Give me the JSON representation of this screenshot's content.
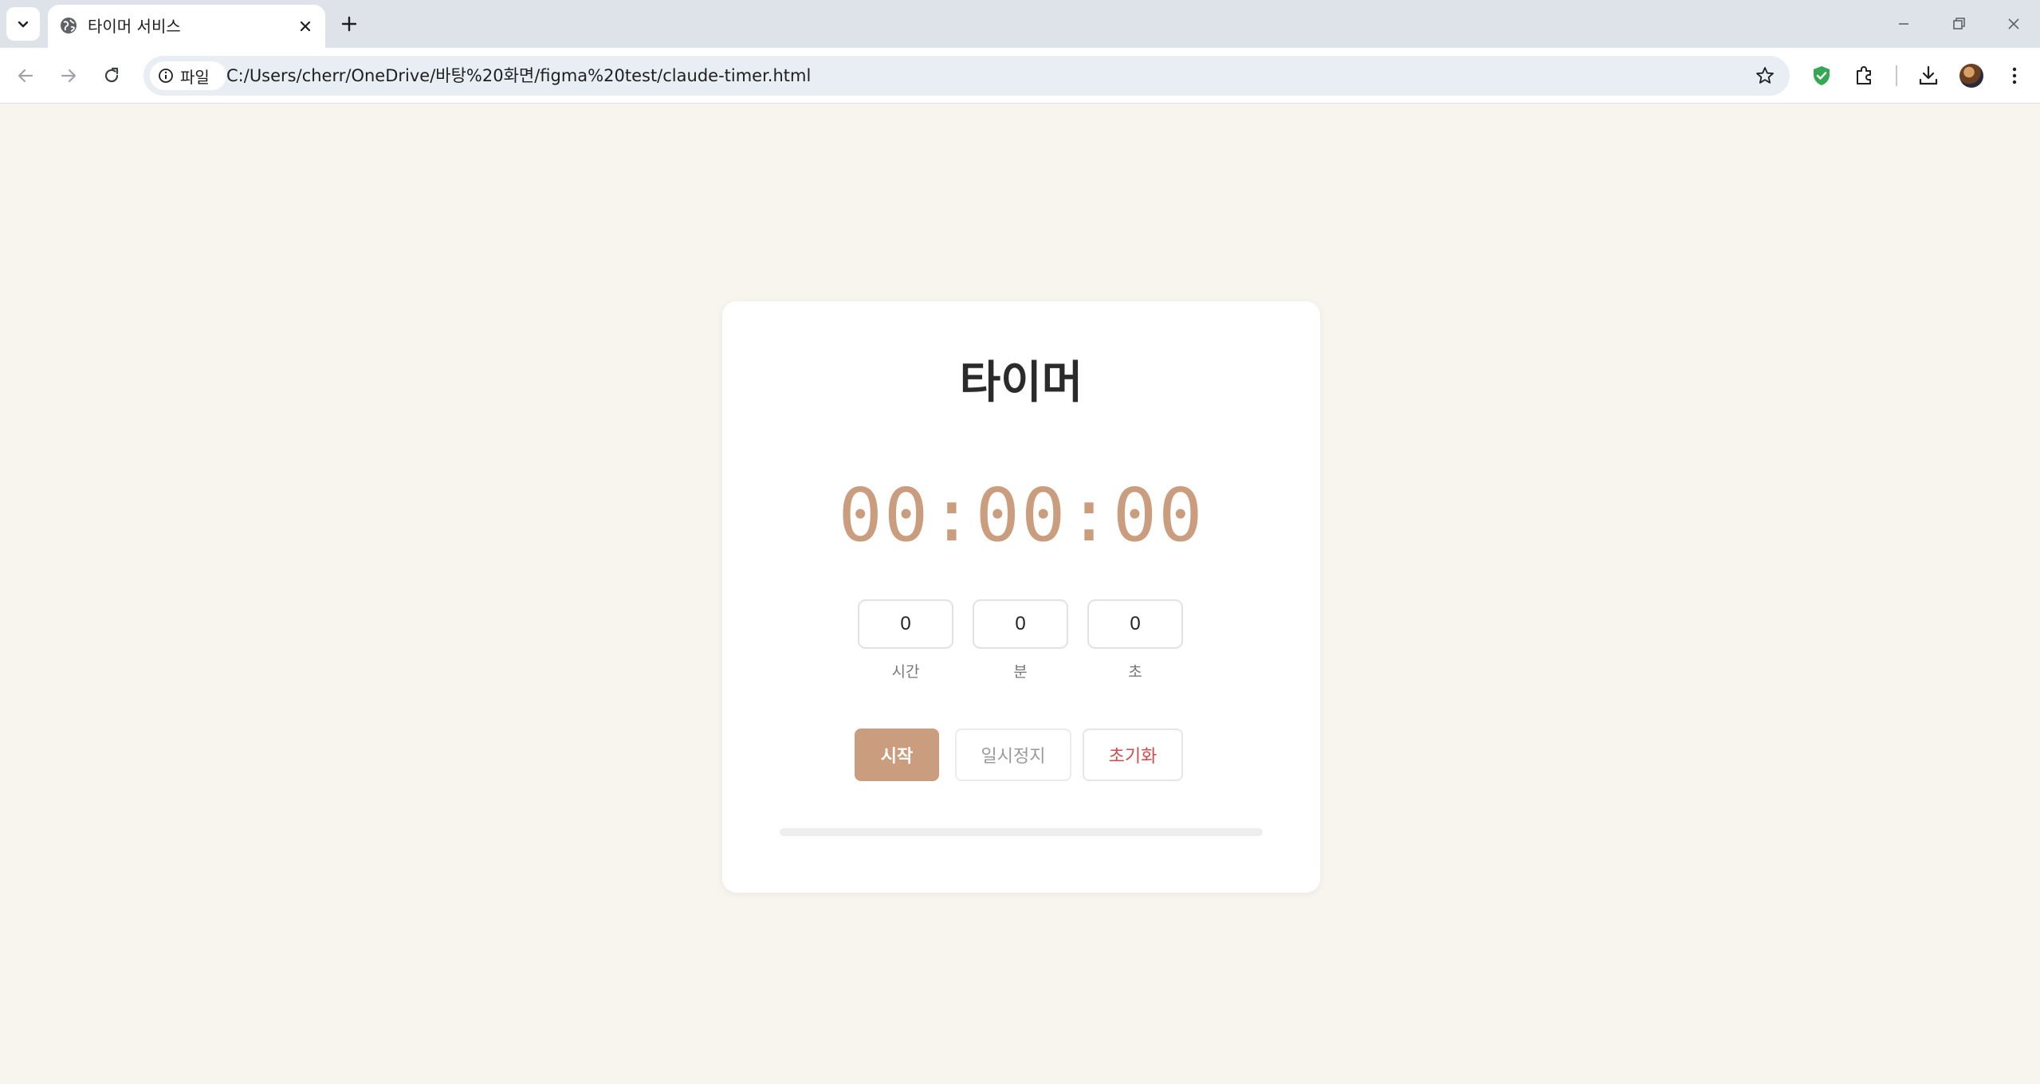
{
  "browser": {
    "tab_title": "타이머 서비스",
    "security_chip_label": "파일",
    "url": "C:/Users/cherr/OneDrive/바탕%20화면/figma%20test/claude-timer.html"
  },
  "timer": {
    "title": "타이머",
    "display": "00:00:00",
    "hours_value": "0",
    "minutes_value": "0",
    "seconds_value": "0",
    "hours_label": "시간",
    "minutes_label": "분",
    "seconds_label": "초",
    "start_label": "시작",
    "pause_label": "일시정지",
    "reset_label": "초기화",
    "progress": 0
  },
  "colors": {
    "accent": "#c99d7d",
    "reset_text": "#d24b4b",
    "page_bg": "#f8f5ef"
  },
  "icons": [
    "chevron-down-icon",
    "globe-icon",
    "close-icon",
    "plus-icon",
    "minimize-icon",
    "restore-icon",
    "window-close-icon",
    "back-arrow-icon",
    "forward-arrow-icon",
    "reload-icon",
    "info-icon",
    "star-icon",
    "shield-icon",
    "extensions-icon",
    "download-icon",
    "menu-icon"
  ]
}
